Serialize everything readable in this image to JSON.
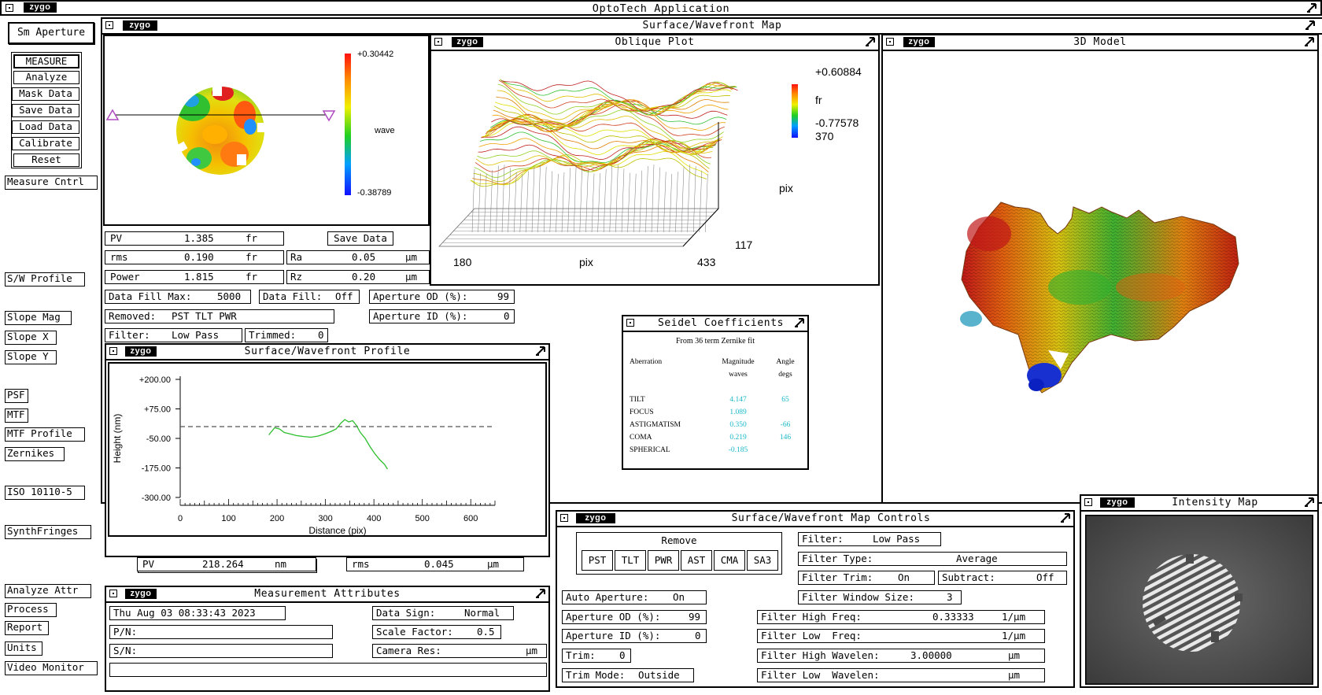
{
  "app": {
    "title": "OptoTech Application",
    "logo": "zygo"
  },
  "left_panel": {
    "top_button": "Sm Aperture",
    "measure_group": [
      "MEASURE",
      "Analyze",
      "Mask Data",
      "Save Data",
      "Load Data",
      "Calibrate",
      "Reset"
    ],
    "measure_cntrl": "Measure Cntrl",
    "analysis_buttons": {
      "sw_profile": "S/W Profile",
      "slope_mag": "Slope Mag",
      "slope_x": "Slope X",
      "slope_y": "Slope Y",
      "psf": "PSF",
      "mtf": "MTF",
      "mtf_profile": "MTF Profile",
      "zernikes": "Zernikes",
      "iso": "ISO 10110-5",
      "synthfringes": "SynthFringes"
    },
    "bottom_buttons": [
      "Analyze Attr",
      "Process",
      "Report",
      "Units",
      "Video Monitor"
    ]
  },
  "surface_map": {
    "title": "Surface/Wavefront Map",
    "scale_max": "+0.30442",
    "scale_min": "-0.38789",
    "scale_unit": "wave",
    "results": {
      "pv": {
        "label": "PV",
        "value": "1.385",
        "unit": "fr"
      },
      "rms": {
        "label": "rms",
        "value": "0.190",
        "unit": "fr"
      },
      "power": {
        "label": "Power",
        "value": "1.815",
        "unit": "fr"
      },
      "save_data": "Save Data",
      "ra": {
        "label": "Ra",
        "value": "0.05",
        "unit": "µm"
      },
      "rz": {
        "label": "Rz",
        "value": "0.20",
        "unit": "µm"
      }
    },
    "data_fill_max": {
      "label": "Data Fill Max:",
      "value": "5000"
    },
    "data_fill": {
      "label": "Data Fill:",
      "value": "Off"
    },
    "aperture_od": {
      "label": "Aperture OD (%):",
      "value": "99"
    },
    "aperture_id": {
      "label": "Aperture ID (%):",
      "value": "0"
    },
    "removed": {
      "label": "Removed:",
      "value": "PST TLT PWR"
    },
    "filter": {
      "label": "Filter:",
      "value": "Low Pass"
    },
    "trimmed": {
      "label": "Trimmed:",
      "value": "0"
    }
  },
  "oblique_plot": {
    "title": "Oblique Plot",
    "scale_max": "+0.60884",
    "scale_unit": "fr",
    "scale_min": "-0.77578",
    "y_end": "370",
    "y_axis_label": "pix",
    "y_start": "117",
    "x_start": "180",
    "x_axis_label": "pix",
    "x_end": "433"
  },
  "model_3d": {
    "title": "3D Model"
  },
  "seidel": {
    "title": "Seidel Coefficients",
    "subtitle": "From 36 term Zernike fit",
    "headers": {
      "aberration": "Aberration",
      "magnitude": "Magnitude",
      "magnitude_unit": "waves",
      "angle": "Angle",
      "angle_unit": "degs"
    },
    "rows": [
      {
        "name": "TILT",
        "magnitude": "4.147",
        "angle": "65"
      },
      {
        "name": "FOCUS",
        "magnitude": "1.089",
        "angle": ""
      },
      {
        "name": "ASTIGMATISM",
        "magnitude": "0.350",
        "angle": "-66"
      },
      {
        "name": "COMA",
        "magnitude": "0.219",
        "angle": "146"
      },
      {
        "name": "SPHERICAL",
        "magnitude": "-0.185",
        "angle": ""
      }
    ]
  },
  "profile": {
    "title": "Surface/Wavefront Profile",
    "pv": {
      "label": "PV",
      "value": "218.264",
      "unit": "nm"
    },
    "rms": {
      "label": "rms",
      "value": "0.045",
      "unit": "µm"
    },
    "chart_data": {
      "type": "line",
      "xlabel": "Distance (pix)",
      "ylabel": "Height (nm)",
      "xlim": [
        0,
        650
      ],
      "ylim": [
        -300,
        200
      ],
      "xticks": [
        0,
        100,
        200,
        300,
        400,
        500,
        600
      ],
      "yticks": [
        200,
        75,
        -50,
        -175,
        -300
      ],
      "ytick_labels": [
        "+200.00",
        "+75.00",
        "-50.00",
        "-175.00",
        "-300.00"
      ],
      "reference_line_y": 0,
      "series": [
        {
          "color": "#2dbe2d",
          "x": [
            183,
            195,
            205,
            215,
            225,
            240,
            255,
            270,
            285,
            300,
            312,
            322,
            332,
            340,
            348,
            356,
            364,
            372,
            382,
            392,
            402,
            412,
            422,
            428
          ],
          "y": [
            -35,
            -5,
            -10,
            -25,
            -30,
            -38,
            -42,
            -45,
            -40,
            -30,
            -20,
            -10,
            15,
            30,
            20,
            25,
            5,
            -25,
            -50,
            -85,
            -115,
            -140,
            -160,
            -180
          ]
        }
      ]
    }
  },
  "measurement_attributes": {
    "title": "Measurement Attributes",
    "date": "Thu Aug 03 08:33:43 2023",
    "pn_label": "P/N:",
    "sn_label": "S/N:",
    "data_sign": {
      "label": "Data Sign:",
      "value": "Normal"
    },
    "scale_factor": {
      "label": "Scale Factor:",
      "value": "0.5"
    },
    "camera_res": {
      "label": "Camera Res:",
      "value": "",
      "unit": "µm"
    }
  },
  "map_controls": {
    "title": "Surface/Wavefront Map Controls",
    "remove_label": "Remove",
    "remove_buttons": [
      "PST",
      "TLT",
      "PWR",
      "AST",
      "CMA",
      "SA3"
    ],
    "filter": {
      "label": "Filter:",
      "value": "Low Pass"
    },
    "filter_type": {
      "label": "Filter Type:",
      "value": "Average"
    },
    "filter_trim": {
      "label": "Filter Trim:",
      "value": "On"
    },
    "subtract": {
      "label": "Subtract:",
      "value": "Off"
    },
    "filter_window_size": {
      "label": "Filter Window Size:",
      "value": "3"
    },
    "auto_aperture": {
      "label": "Auto Aperture:",
      "value": "On"
    },
    "aperture_od": {
      "label": "Aperture OD (%):",
      "value": "99"
    },
    "aperture_id": {
      "label": "Aperture ID (%):",
      "value": "0"
    },
    "trim": {
      "label": "Trim:",
      "value": "0"
    },
    "trim_mode": {
      "label": "Trim Mode:",
      "value": "Outside"
    },
    "filter_high_freq": {
      "label": "Filter High Freq:",
      "value": "0.33333",
      "unit": "1/µm"
    },
    "filter_low_freq": {
      "label": "Filter Low  Freq:",
      "value": "",
      "unit": "1/µm"
    },
    "filter_high_wavelen": {
      "label": "Filter High Wavelen:",
      "value": "3.00000",
      "unit": "µm"
    },
    "filter_low_wavelen": {
      "label": "Filter Low  Wavelen:",
      "value": "",
      "unit": "µm"
    }
  },
  "intensity_map": {
    "title": "Intensity Map"
  }
}
